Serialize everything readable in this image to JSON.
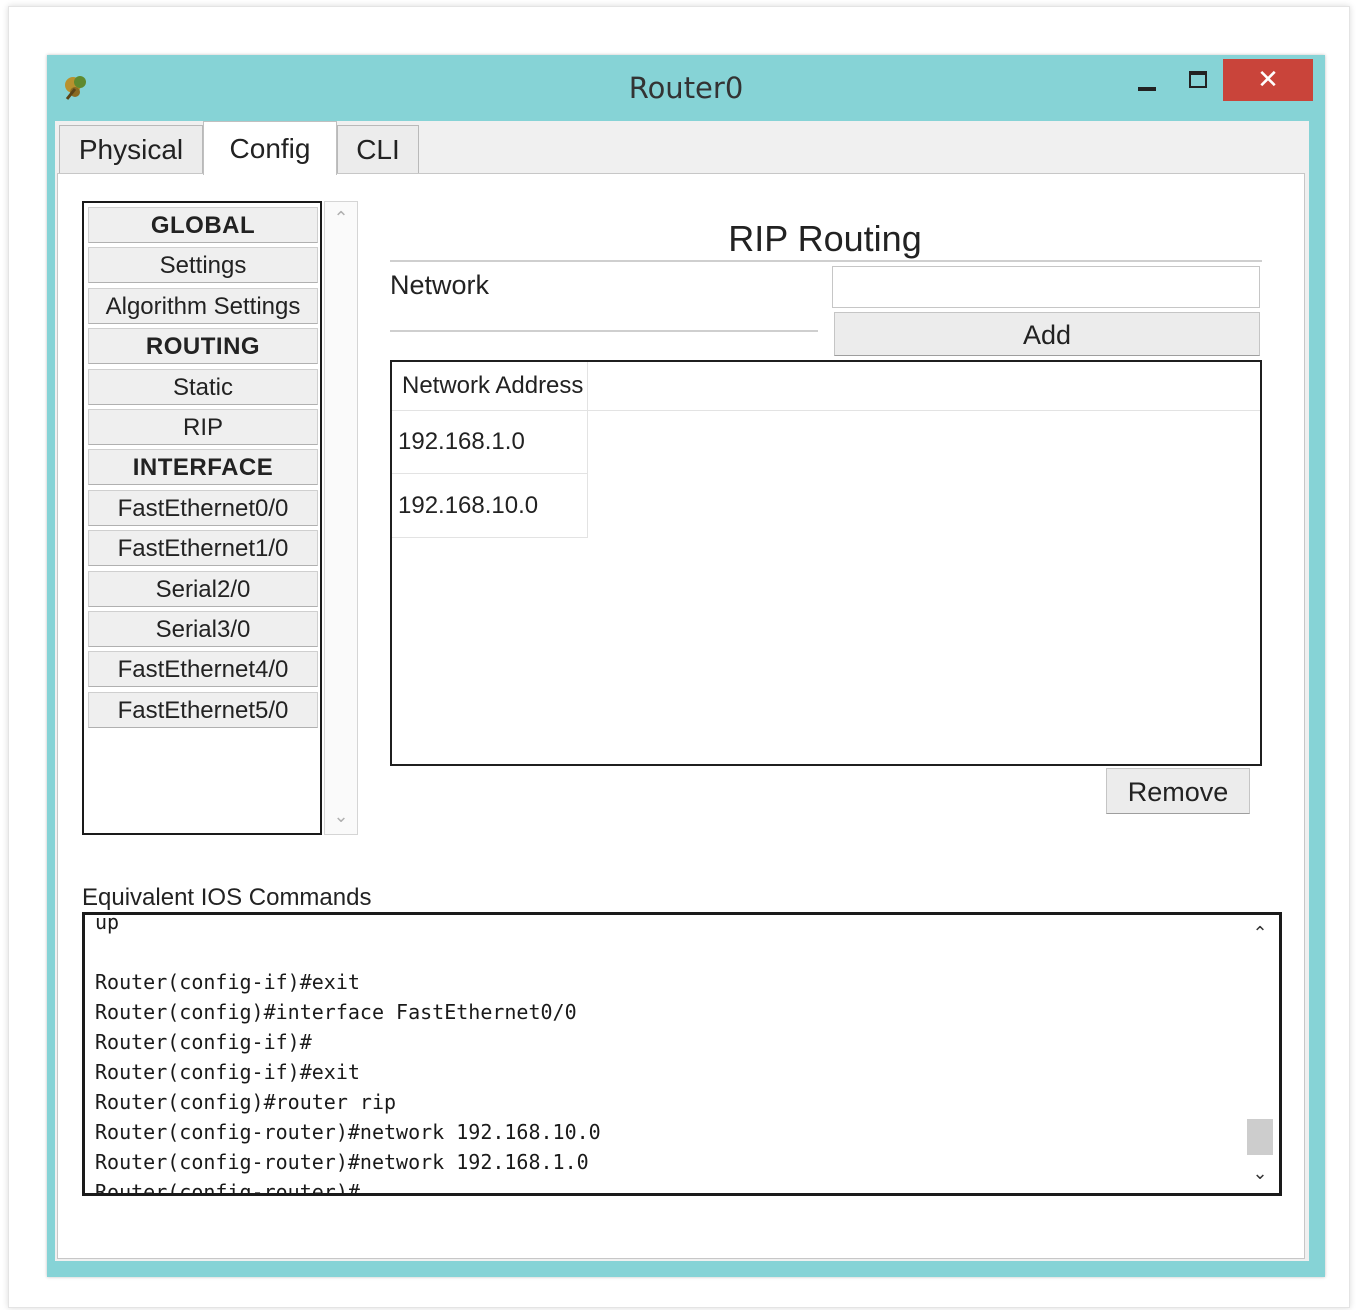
{
  "window": {
    "title": "Router0",
    "close_label": "✕"
  },
  "tabs": [
    {
      "label": "Physical",
      "active": false
    },
    {
      "label": "Config",
      "active": true
    },
    {
      "label": "CLI",
      "active": false
    }
  ],
  "sidebar": {
    "items": [
      {
        "label": "GLOBAL",
        "heading": true
      },
      {
        "label": "Settings",
        "heading": false
      },
      {
        "label": "Algorithm Settings",
        "heading": false
      },
      {
        "label": "ROUTING",
        "heading": true
      },
      {
        "label": "Static",
        "heading": false
      },
      {
        "label": "RIP",
        "heading": false
      },
      {
        "label": "INTERFACE",
        "heading": true
      },
      {
        "label": "FastEthernet0/0",
        "heading": false
      },
      {
        "label": "FastEthernet1/0",
        "heading": false
      },
      {
        "label": "Serial2/0",
        "heading": false
      },
      {
        "label": "Serial3/0",
        "heading": false
      },
      {
        "label": "FastEthernet4/0",
        "heading": false
      },
      {
        "label": "FastEthernet5/0",
        "heading": false
      }
    ],
    "scroll_up_glyph": "⌃",
    "scroll_down_glyph": "⌄"
  },
  "rip": {
    "title": "RIP Routing",
    "network_label": "Network",
    "network_value": "",
    "add_label": "Add",
    "remove_label": "Remove",
    "table": {
      "column": "Network Address",
      "rows": [
        "192.168.1.0",
        "192.168.10.0"
      ]
    }
  },
  "ios": {
    "label": "Equivalent IOS Commands",
    "lines": [
      "up",
      "",
      "Router(config-if)#exit",
      "Router(config)#interface FastEthernet0/0",
      "Router(config-if)#",
      "Router(config-if)#exit",
      "Router(config)#router rip",
      "Router(config-router)#network 192.168.10.0",
      "Router(config-router)#network 192.168.1.0",
      "Router(config-router)#"
    ],
    "scroll_up_glyph": "⌃",
    "scroll_down_glyph": "⌄"
  },
  "colors": {
    "titlebar": "#86d3d6",
    "close_button": "#c9443a"
  }
}
